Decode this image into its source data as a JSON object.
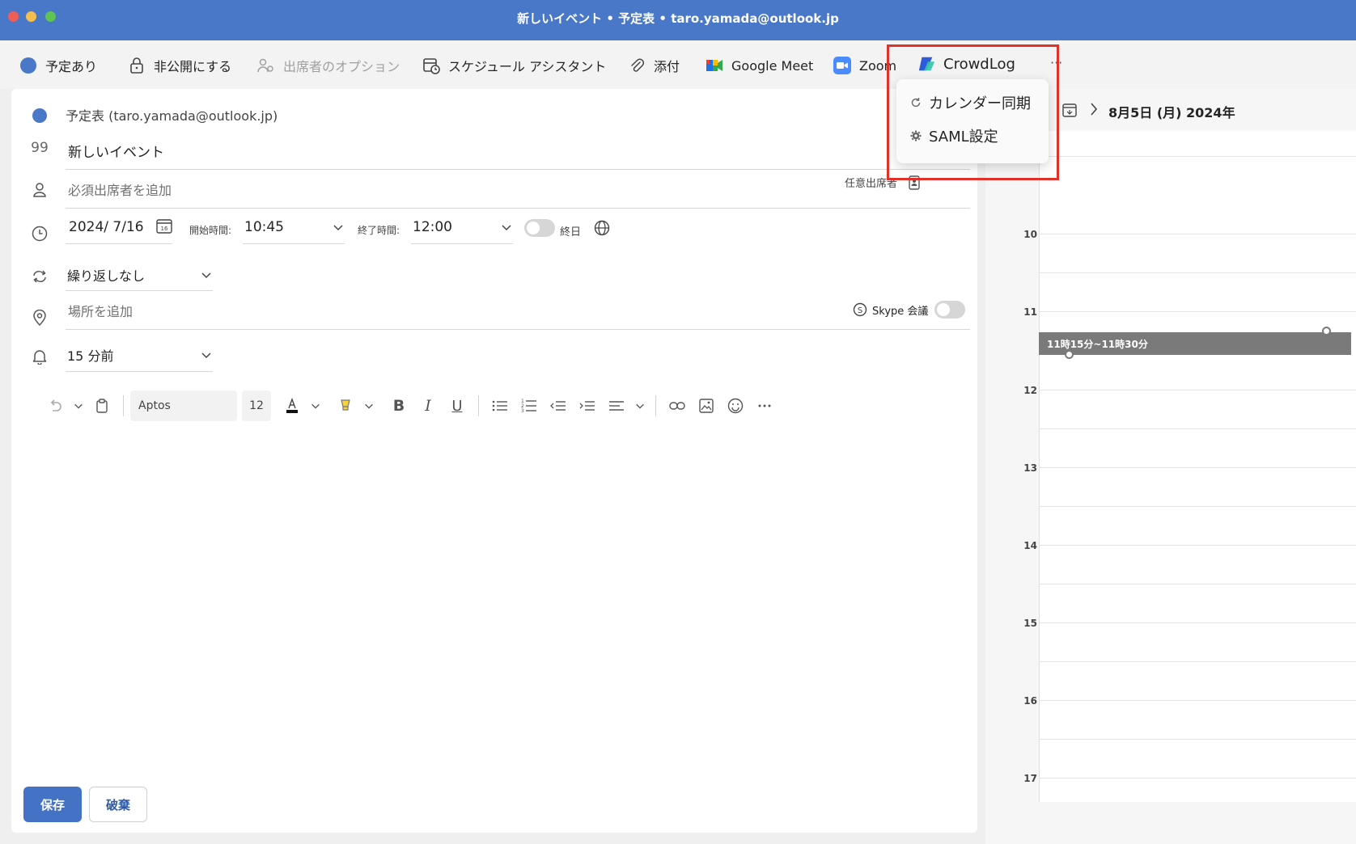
{
  "window": {
    "title": "新しいイベント • 予定表 • taro.yamada@outlook.jp"
  },
  "ribbon": {
    "busy": "予定あり",
    "private": "非公開にする",
    "attendee_options": "出席者のオプション",
    "schedule_assistant": "スケジュール アシスタント",
    "attach": "添付",
    "google_meet": "Google Meet",
    "zoom": "Zoom",
    "crowdlog": "CrowdLog",
    "more": "···"
  },
  "crowdlog_menu": {
    "items": [
      {
        "label": "カレンダー同期",
        "icon": "sync-icon"
      },
      {
        "label": "SAML設定",
        "icon": "gear-icon"
      }
    ]
  },
  "form": {
    "calendar": "予定表 (taro.yamada@outlook.jp)",
    "title_value": "新しいイベント",
    "required_attendees_placeholder": "必須出席者を追加",
    "optional_attendees": "任意出席者",
    "date": "2024/ 7/16",
    "start_label": "開始時間:",
    "start_time": "10:45",
    "end_label": "終了時間:",
    "end_time": "12:00",
    "all_day": "終日",
    "recurrence": "繰り返しなし",
    "location_placeholder": "場所を追加",
    "skype": "Skype 会議",
    "reminder": "15 分前"
  },
  "editor": {
    "font": "Aptos",
    "size": "12"
  },
  "footer": {
    "save": "保存",
    "discard": "破棄"
  },
  "calendar_panel": {
    "date": "8月5日 (月) 2024年",
    "hours": [
      "10",
      "11",
      "12",
      "13",
      "14",
      "15",
      "16",
      "17"
    ],
    "event_label": "11時15分~11時30分"
  },
  "colors": {
    "titlebar": "#4a78c8",
    "accent": "#4472c4",
    "highlight": "#e0322b"
  }
}
